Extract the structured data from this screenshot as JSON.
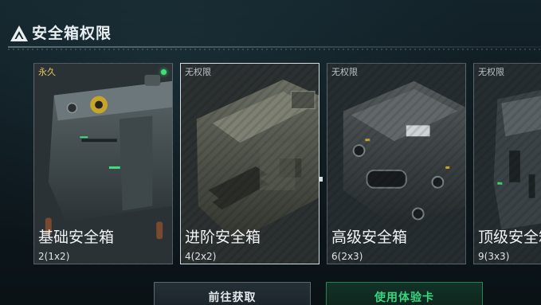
{
  "header": {
    "title": "安全箱权限",
    "icon": "warning-triangle-icon"
  },
  "cards": [
    {
      "status": "永久",
      "name": "基础安全箱",
      "capacity": "2(1x2)",
      "active": true,
      "selected": false
    },
    {
      "status": "无权限",
      "name": "进阶安全箱",
      "capacity": "4(2x2)",
      "active": false,
      "selected": true
    },
    {
      "status": "无权限",
      "name": "高级安全箱",
      "capacity": "6(2x3)",
      "active": false,
      "selected": false
    },
    {
      "status": "无权限",
      "name": "顶级安全箱",
      "capacity": "9(3x3)",
      "active": false,
      "selected": false
    }
  ],
  "buttons": {
    "acquire_label": "前往获取",
    "trial_label": "使用体验卡"
  },
  "colors": {
    "permanent": "#e6c760",
    "active_indicator": "#3fe07a",
    "trial_accent": "#39d680"
  }
}
